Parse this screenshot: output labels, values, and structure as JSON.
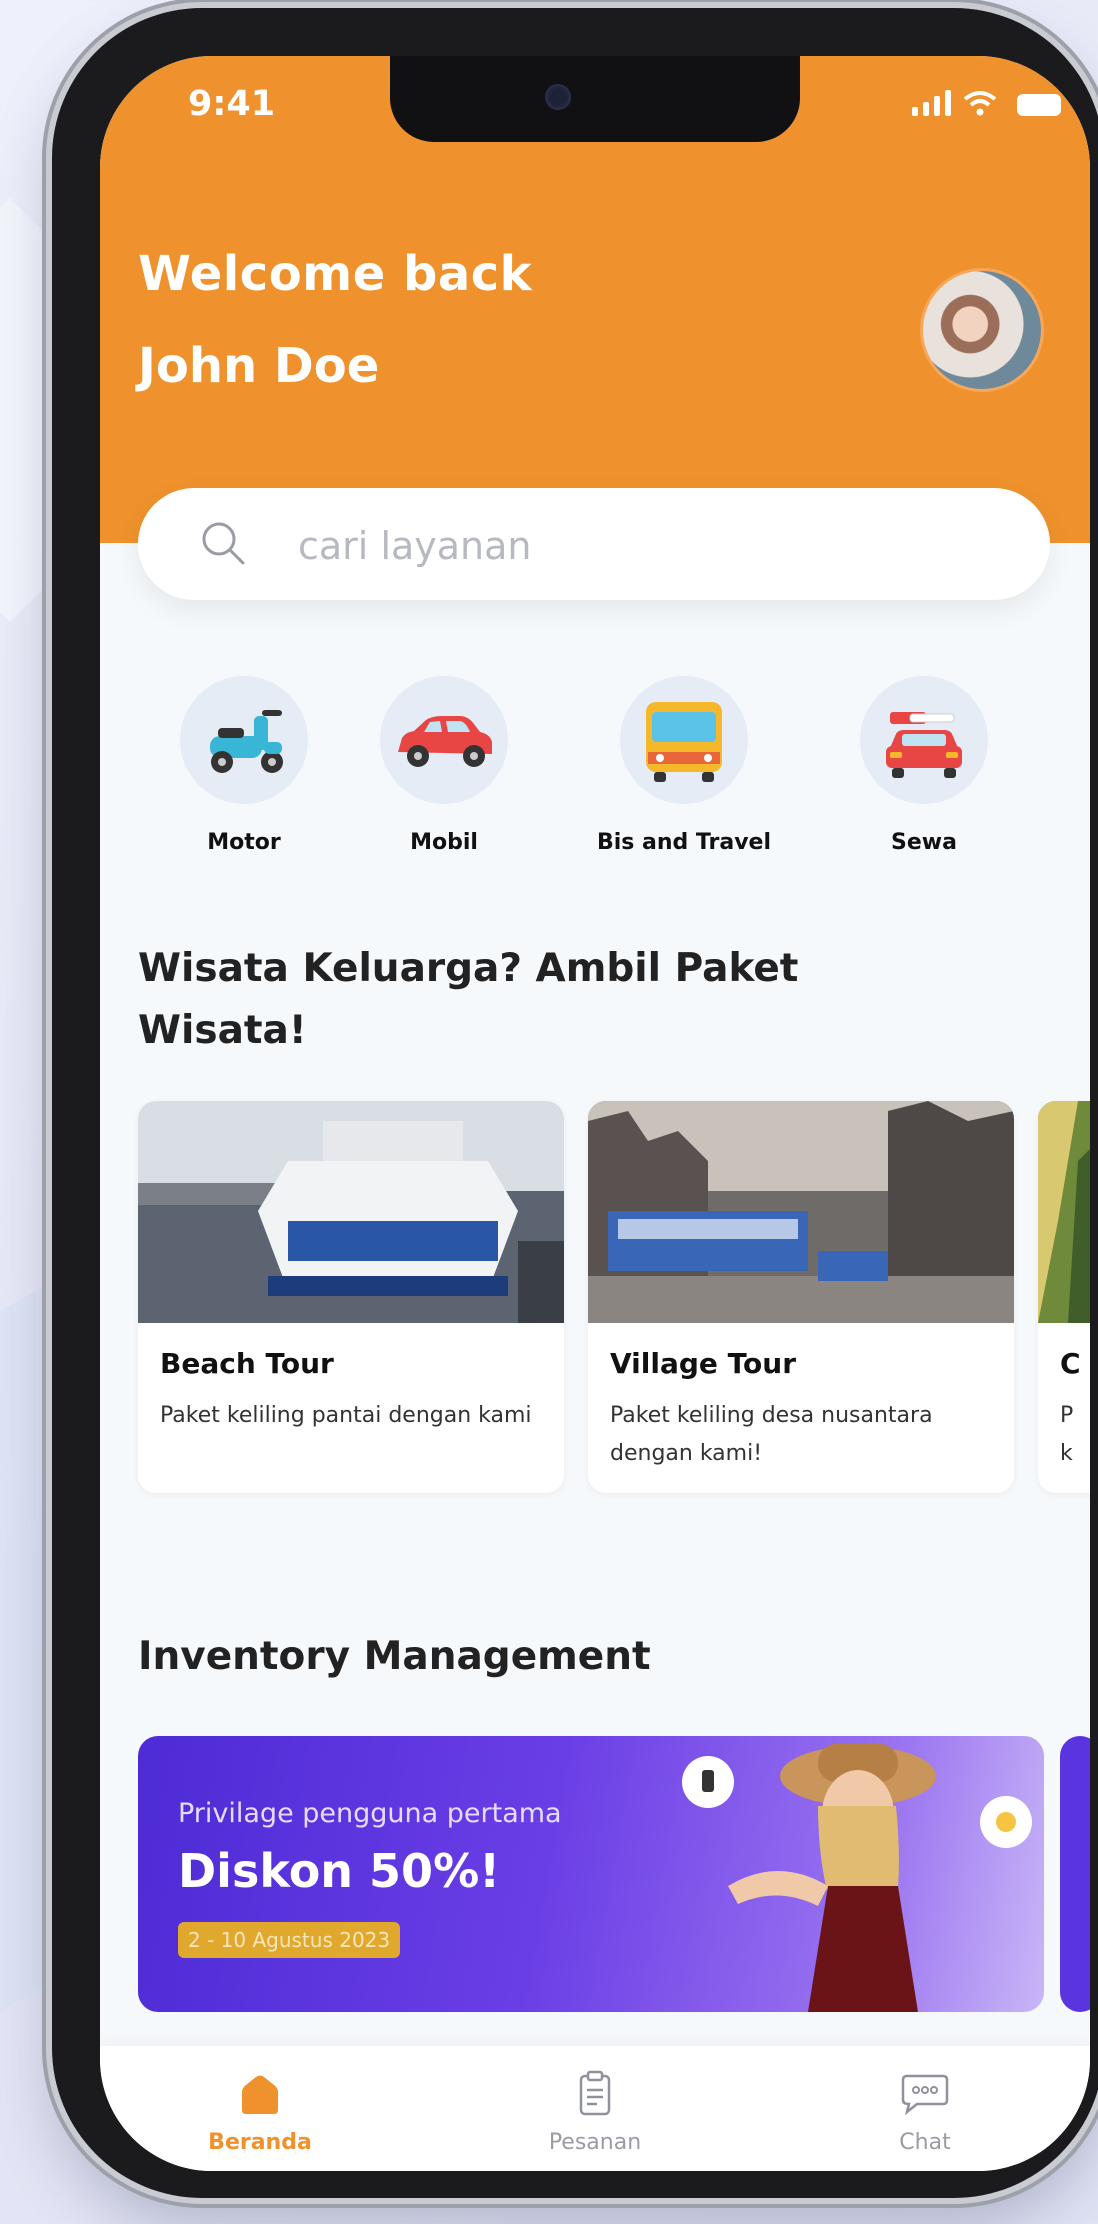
{
  "status_bar": {
    "time": "9:41"
  },
  "header": {
    "greeting": "Welcome back",
    "user_name": "John Doe"
  },
  "search": {
    "placeholder": "cari layanan"
  },
  "categories": [
    {
      "label": "Motor",
      "icon": "scooter-icon"
    },
    {
      "label": "Mobil",
      "icon": "car-icon"
    },
    {
      "label": "Bis and Travel",
      "icon": "bus-icon"
    },
    {
      "label": "Sewa",
      "icon": "rental-car-icon"
    }
  ],
  "tour_section": {
    "title_line1": "Wisata Keluarga? Ambil Paket",
    "title_line2": "Wisata!"
  },
  "tours": [
    {
      "title": "Beach Tour",
      "description": "Paket keliling pantai dengan kami"
    },
    {
      "title": "Village Tour",
      "description": "Paket keliling desa nusantara dengan kami!"
    },
    {
      "title": "C",
      "description": "P k"
    }
  ],
  "inventory_section": {
    "title": "Inventory Management"
  },
  "promo": {
    "subtitle": "Privilage pengguna pertama",
    "title": "Diskon 50%!",
    "date": "2 - 10 Agustus 2023"
  },
  "bottom_nav": [
    {
      "label": "Beranda",
      "icon": "home-icon",
      "active": true
    },
    {
      "label": "Pesanan",
      "icon": "clipboard-icon",
      "active": false
    },
    {
      "label": "Chat",
      "icon": "chat-icon",
      "active": false
    }
  ],
  "colors": {
    "primary": "#ef922d",
    "promo": "#5a34df",
    "background": "#f6f9fc"
  }
}
